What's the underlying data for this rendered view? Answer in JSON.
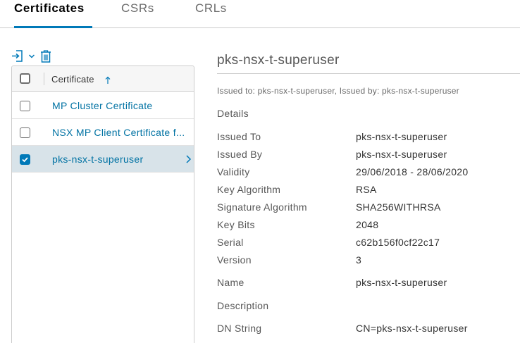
{
  "tabs": [
    {
      "label": "Certificates",
      "active": true
    },
    {
      "label": "CSRs",
      "active": false
    },
    {
      "label": "CRLs",
      "active": false
    }
  ],
  "toolbar": {
    "import_icon": "import-icon",
    "menu_icon": "chevron-down-icon",
    "delete_icon": "trash-icon"
  },
  "grid": {
    "header": "Certificate",
    "sort_icon": "arrow-up-icon",
    "rows": [
      {
        "label": "MP Cluster Certificate",
        "checked": false,
        "selected": false
      },
      {
        "label": "NSX MP Client Certificate f...",
        "checked": false,
        "selected": false
      },
      {
        "label": "pks-nsx-t-superuser",
        "checked": true,
        "selected": true
      }
    ]
  },
  "detail": {
    "title": "pks-nsx-t-superuser",
    "issued_line": "Issued to: pks-nsx-t-superuser, Issued by: pks-nsx-t-superuser",
    "section": "Details",
    "fields": [
      {
        "label": "Issued To",
        "value": "pks-nsx-t-superuser"
      },
      {
        "label": "Issued By",
        "value": "pks-nsx-t-superuser"
      },
      {
        "label": "Validity",
        "value": "29/06/2018 - 28/06/2020"
      },
      {
        "label": "Key Algorithm",
        "value": "RSA"
      },
      {
        "label": "Signature Algorithm",
        "value": "SHA256WITHRSA"
      },
      {
        "label": "Key Bits",
        "value": "2048"
      },
      {
        "label": "Serial",
        "value": "c62b156f0cf22c17"
      },
      {
        "label": "Version",
        "value": "3"
      },
      {
        "label": "Name",
        "value": "pks-nsx-t-superuser"
      },
      {
        "label": "Description",
        "value": ""
      },
      {
        "label": "DN String",
        "value": "CN=pks-nsx-t-superuser"
      }
    ]
  },
  "colors": {
    "accent": "#0079b8",
    "link": "#0072a3",
    "selected_row": "#d8e3e9"
  }
}
